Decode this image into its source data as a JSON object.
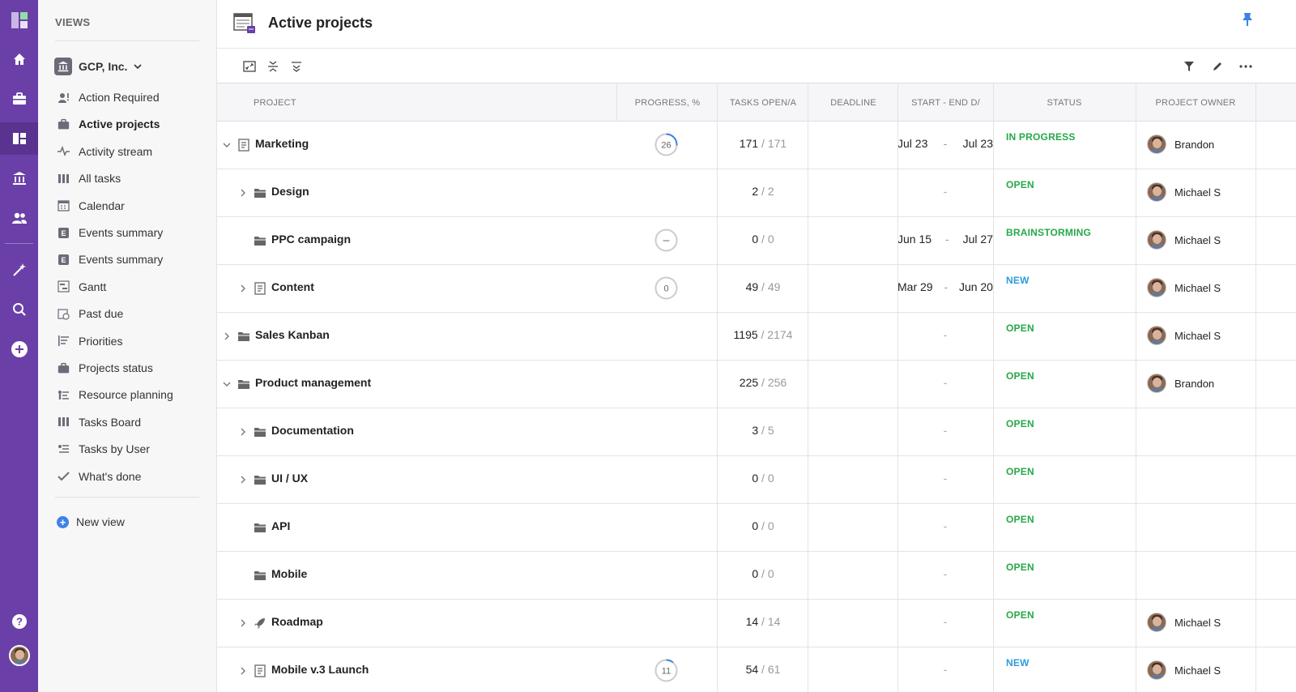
{
  "rail": {
    "items": [
      "logo-icon",
      "home-icon",
      "briefcase-icon",
      "dashboard-icon",
      "bank-icon",
      "users-icon",
      "magic-wand-icon",
      "search-icon",
      "add-icon",
      "help-icon",
      "profile-avatar"
    ]
  },
  "views": {
    "title": "VIEWS",
    "org": "GCP, Inc.",
    "items": [
      {
        "label": "Action Required",
        "icon": "user-alert-icon"
      },
      {
        "label": "Active projects",
        "icon": "briefcase-icon"
      },
      {
        "label": "Activity stream",
        "icon": "pulse-icon"
      },
      {
        "label": "All tasks",
        "icon": "columns-icon"
      },
      {
        "label": "Calendar",
        "icon": "calendar-icon"
      },
      {
        "label": "Events summary",
        "icon": "event-icon"
      },
      {
        "label": "Events summary",
        "icon": "event-icon"
      },
      {
        "label": "Gantt",
        "icon": "gantt-icon"
      },
      {
        "label": "Past due",
        "icon": "clock-calendar-icon"
      },
      {
        "label": "Priorities",
        "icon": "priorities-icon"
      },
      {
        "label": "Projects status",
        "icon": "briefcase-icon"
      },
      {
        "label": "Resource planning",
        "icon": "resource-icon"
      },
      {
        "label": "Tasks Board",
        "icon": "columns-icon"
      },
      {
        "label": "Tasks by User",
        "icon": "user-list-icon"
      },
      {
        "label": "What's done",
        "icon": "check-icon"
      }
    ],
    "new_view": "New view"
  },
  "header": {
    "title": "Active projects"
  },
  "table": {
    "columns": {
      "project": "PROJECT",
      "progress": "PROGRESS, %",
      "tasks": "TASKS OPEN/A",
      "deadline": "DEADLINE",
      "dates": "START - END D/",
      "status": "STATUS",
      "owner": "PROJECT OWNER"
    },
    "rows": [
      {
        "name": "Marketing",
        "progress": "26",
        "open": "171",
        "total": "/ 171",
        "start": "Jul 23",
        "end": "Jul 23",
        "status": "IN PROGRESS",
        "owner": "Brandon"
      },
      {
        "name": "Design",
        "progress": "",
        "open": "2",
        "total": "/ 2",
        "nodate": "-",
        "status": "OPEN",
        "owner": "Michael S"
      },
      {
        "name": "PPC campaign",
        "progress": "–",
        "open": "0",
        "total": "/ 0",
        "start": "Jun 15",
        "end": "Jul 27",
        "status": "BRAINSTORMING",
        "owner": "Michael S"
      },
      {
        "name": "Content",
        "progress": "0",
        "open": "49",
        "total": "/ 49",
        "start": "Mar 29",
        "end": "Jun 20",
        "status": "NEW",
        "owner": "Michael S"
      },
      {
        "name": "Sales Kanban",
        "progress": "",
        "open": "1195",
        "total": "/ 2174",
        "nodate": "-",
        "status": "OPEN",
        "owner": "Michael S"
      },
      {
        "name": "Product management",
        "progress": "",
        "open": "225",
        "total": "/ 256",
        "nodate": "-",
        "status": "OPEN",
        "owner": "Brandon"
      },
      {
        "name": "Documentation",
        "progress": "",
        "open": "3",
        "total": "/ 5",
        "nodate": "-",
        "status": "OPEN",
        "owner": ""
      },
      {
        "name": "UI / UX",
        "progress": "",
        "open": "0",
        "total": "/ 0",
        "nodate": "-",
        "status": "OPEN",
        "owner": ""
      },
      {
        "name": "API",
        "progress": "",
        "open": "0",
        "total": "/ 0",
        "nodate": "-",
        "status": "OPEN",
        "owner": ""
      },
      {
        "name": "Mobile",
        "progress": "",
        "open": "0",
        "total": "/ 0",
        "nodate": "-",
        "status": "OPEN",
        "owner": ""
      },
      {
        "name": "Roadmap",
        "progress": "",
        "open": "14",
        "total": "/ 14",
        "nodate": "-",
        "status": "OPEN",
        "owner": "Michael S"
      },
      {
        "name": "Mobile v.3 Launch",
        "progress": "11",
        "open": "54",
        "total": "/ 61",
        "nodate": "-",
        "status": "NEW",
        "owner": "Michael S"
      }
    ]
  },
  "colors": {
    "rail": "#6b3fa8",
    "open": "#27a84a",
    "new": "#2d9cdb",
    "progress_arc": "#3d82e6"
  }
}
